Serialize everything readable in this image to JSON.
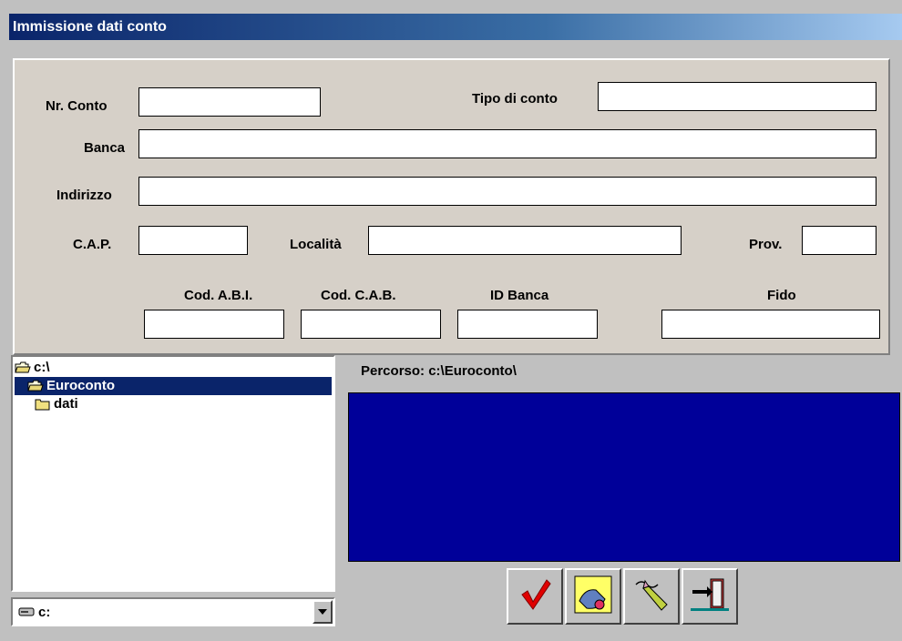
{
  "window": {
    "title": "Immissione dati conto"
  },
  "form": {
    "nr_conto_label": "Nr. Conto",
    "tipo_conto_label": "Tipo di conto",
    "banca_label": "Banca",
    "indirizzo_label": "Indirizzo",
    "cap_label": "C.A.P.",
    "localita_label": "Località",
    "prov_label": "Prov.",
    "abi_label": "Cod. A.B.I.",
    "cab_label": "Cod. C.A.B.",
    "id_banca_label": "ID Banca",
    "fido_label": "Fido",
    "nr_conto_value": "",
    "tipo_conto_value": "",
    "banca_value": "",
    "indirizzo_value": "",
    "cap_value": "",
    "localita_value": "",
    "prov_value": "",
    "abi_value": "",
    "cab_value": "",
    "id_banca_value": "",
    "fido_value": ""
  },
  "tree": {
    "items": [
      {
        "label": "c:\\",
        "icon": "open-folder-icon",
        "selected": false
      },
      {
        "label": "Euroconto",
        "icon": "open-folder-icon",
        "selected": true
      },
      {
        "label": "dati",
        "icon": "closed-folder-icon",
        "selected": false
      }
    ]
  },
  "drive": {
    "value": "c:",
    "icon": "drive-icon"
  },
  "path": {
    "label": "Percorso: c:\\Euroconto\\"
  },
  "toolbar": {
    "buttons": [
      {
        "icon": "checkmark-icon"
      },
      {
        "icon": "eraser-hand-icon"
      },
      {
        "icon": "brush-icon"
      },
      {
        "icon": "exit-door-icon"
      }
    ]
  },
  "colors": {
    "titlebar_start": "#0a246a",
    "titlebar_end": "#a6caf0",
    "panel": "#d6d0c8",
    "preview": "#000099",
    "selection": "#0a246a",
    "check": "#e00000"
  }
}
